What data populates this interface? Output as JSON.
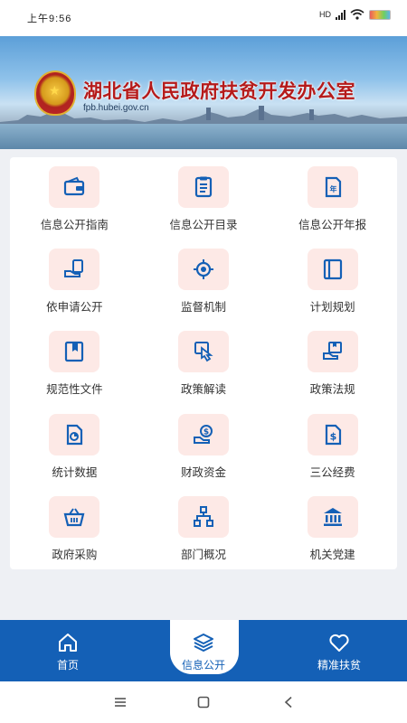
{
  "status_bar": {
    "time": "上午9:56",
    "network": "HD"
  },
  "banner": {
    "title": "湖北省人民政府扶贫开发办公室",
    "url": "fpb.hubei.gov.cn"
  },
  "grid": {
    "items": [
      {
        "label": "信息公开指南",
        "icon": "wallet-icon"
      },
      {
        "label": "信息公开目录",
        "icon": "clipboard-list-icon"
      },
      {
        "label": "信息公开年报",
        "icon": "annual-report-icon"
      },
      {
        "label": "依申请公开",
        "icon": "hand-document-icon"
      },
      {
        "label": "监督机制",
        "icon": "target-icon"
      },
      {
        "label": "计划规划",
        "icon": "notebook-icon"
      },
      {
        "label": "规范性文件",
        "icon": "bookmark-book-icon"
      },
      {
        "label": "政策解读",
        "icon": "touch-screen-icon"
      },
      {
        "label": "政策法规",
        "icon": "hand-folder-icon"
      },
      {
        "label": "统计数据",
        "icon": "pie-chart-document-icon"
      },
      {
        "label": "财政资金",
        "icon": "coin-hand-icon"
      },
      {
        "label": "三公经费",
        "icon": "dollar-document-icon"
      },
      {
        "label": "政府采购",
        "icon": "shopping-basket-icon"
      },
      {
        "label": "部门概况",
        "icon": "org-chart-icon"
      },
      {
        "label": "机关党建",
        "icon": "institution-building-icon"
      }
    ]
  },
  "tab_bar": {
    "tabs": [
      {
        "label": "首页",
        "icon": "home-icon",
        "active": false
      },
      {
        "label": "信息公开",
        "icon": "layers-icon",
        "active": true
      },
      {
        "label": "精准扶贫",
        "icon": "heart-icon",
        "active": false
      }
    ]
  },
  "colors": {
    "primary": "#1460b6",
    "icon_bg": "#fde9e6",
    "title_red": "#b51a1a"
  }
}
